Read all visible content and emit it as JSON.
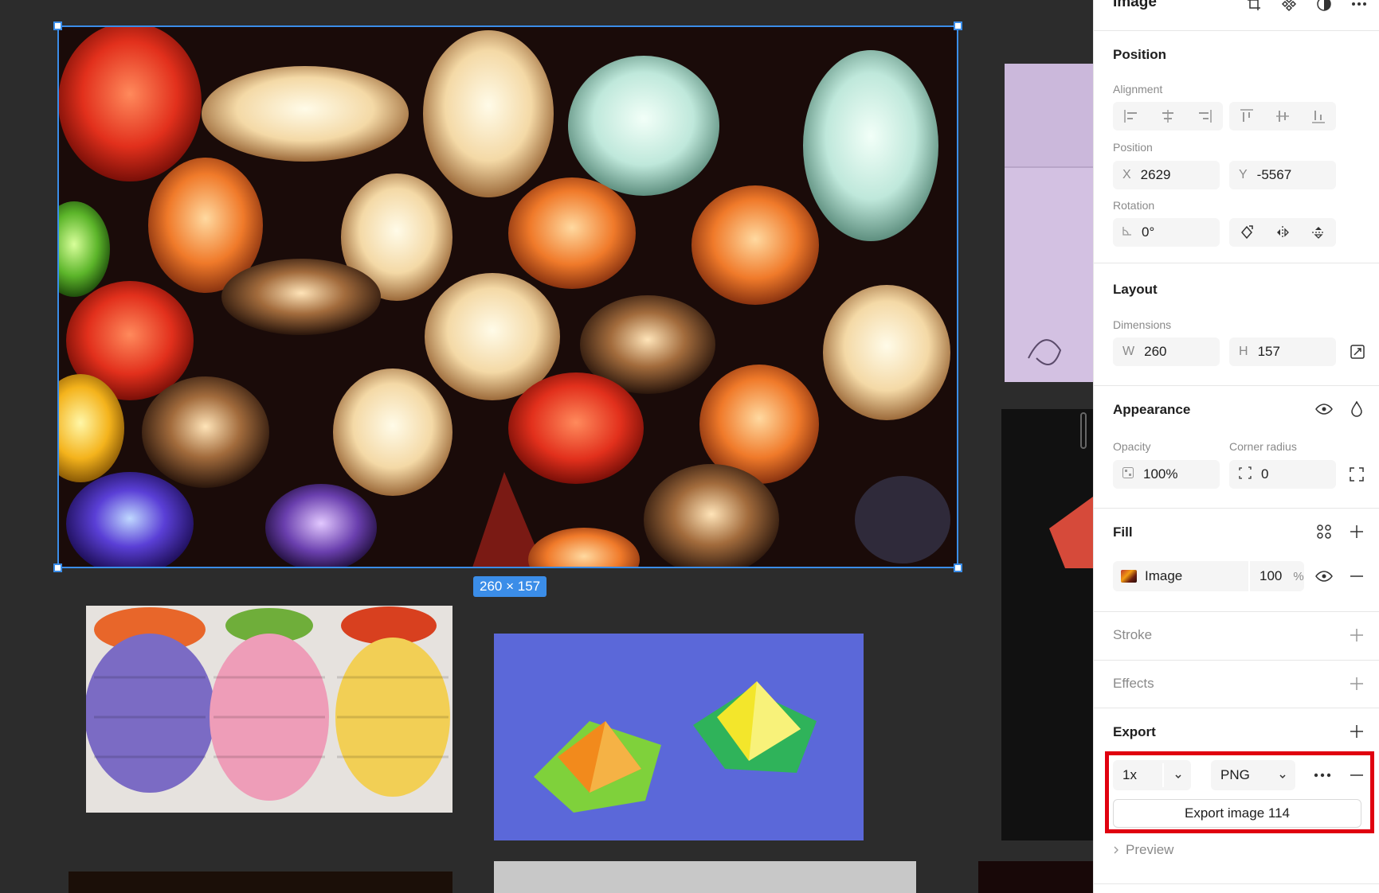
{
  "canvas": {
    "selection_size": "260 × 157"
  },
  "panel": {
    "header_title": "Image",
    "position": {
      "title": "Position",
      "alignment_label": "Alignment",
      "position_label": "Position",
      "x_prefix": "X",
      "x_value": "2629",
      "y_prefix": "Y",
      "y_value": "-5567",
      "rotation_label": "Rotation",
      "rotation_value": "0°"
    },
    "layout": {
      "title": "Layout",
      "dimensions_label": "Dimensions",
      "w_prefix": "W",
      "w_value": "260",
      "h_prefix": "H",
      "h_value": "157"
    },
    "appearance": {
      "title": "Appearance",
      "opacity_label": "Opacity",
      "opacity_value": "100%",
      "corner_radius_label": "Corner radius",
      "corner_radius_value": "0"
    },
    "fill": {
      "title": "Fill",
      "type": "Image",
      "opacity": "100",
      "unit": "%"
    },
    "stroke": {
      "title": "Stroke"
    },
    "effects": {
      "title": "Effects"
    },
    "export": {
      "title": "Export",
      "scale": "1x",
      "format": "PNG",
      "button_label": "Export image 114",
      "preview_label": "Preview"
    }
  },
  "colors": {
    "selection_blue": "#3b8de8",
    "highlight_red": "#e0000f",
    "canvas_bg": "#2c2c2c"
  }
}
